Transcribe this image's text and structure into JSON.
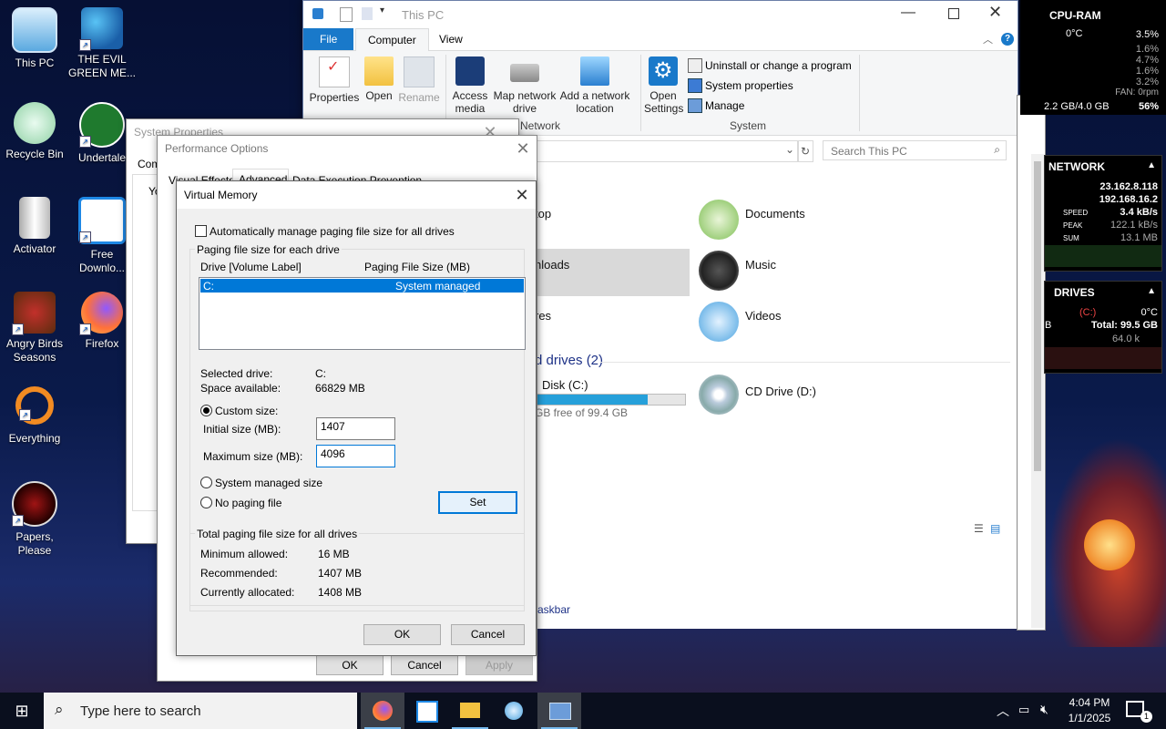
{
  "desktop_icons": [
    {
      "label": "This PC"
    },
    {
      "label": "THE EVIL GREEN ME..."
    },
    {
      "label": "Recycle Bin"
    },
    {
      "label": "Undertale"
    },
    {
      "label": "Activator"
    },
    {
      "label": "Free Downlo..."
    },
    {
      "label": "Angry Birds Seasons"
    },
    {
      "label": "Firefox"
    },
    {
      "label": "Everything"
    },
    {
      "label": "Papers, Please"
    }
  ],
  "explorer": {
    "title": "This PC",
    "tabs": [
      "File",
      "Computer",
      "View"
    ],
    "ribbon": {
      "properties": "Properties",
      "open": "Open",
      "rename": "Rename",
      "access_media": "Access media",
      "map_drive": "Map network drive",
      "add_location": "Add a network location",
      "network_group": "Network",
      "open_settings": "Open Settings",
      "uninstall": "Uninstall or change a program",
      "system_properties": "System properties",
      "manage": "Manage",
      "system_group": "System"
    },
    "search_placeholder": "Search This PC",
    "folders": [
      "top",
      "nloads",
      "res"
    ],
    "folders_right": [
      "Documents",
      "Music",
      "Videos"
    ],
    "drives_heading": "d drives (2)",
    "c_drive_label": "Disk (C:)",
    "c_drive_free": "GB free of 99.4 GB",
    "c_drive_used_fraction": 0.75,
    "d_drive_label": "CD Drive (D:)",
    "partial_text_1": "askbar"
  },
  "system_properties": {
    "title": "System Properties",
    "tab_partial": "Com",
    "y_partial": "Yo"
  },
  "performance_options": {
    "title": "Performance Options",
    "tabs": [
      "Visual Effects",
      "Advanced",
      "Data Execution Prevention"
    ],
    "ok": "OK",
    "cancel": "Cancel",
    "apply": "Apply"
  },
  "virtual_memory": {
    "title": "Virtual Memory",
    "auto_manage": "Automatically manage paging file size for all drives",
    "group_each_drive": "Paging file size for each drive",
    "col_drive": "Drive  [Volume Label]",
    "col_size": "Paging File Size (MB)",
    "rows": [
      {
        "drive": "C:",
        "size": "System managed"
      }
    ],
    "selected_drive_label": "Selected drive:",
    "selected_drive_value": "C:",
    "space_available_label": "Space available:",
    "space_available_value": "66829 MB",
    "custom_size": "Custom size:",
    "initial_size_label": "Initial size (MB):",
    "initial_size_value": "1407",
    "max_size_label": "Maximum size (MB):",
    "max_size_value": "4096",
    "system_managed": "System managed size",
    "no_paging": "No paging file",
    "set": "Set",
    "total_group": "Total paging file size for all drives",
    "min_label": "Minimum allowed:",
    "min_value": "16 MB",
    "rec_label": "Recommended:",
    "rec_value": "1407 MB",
    "cur_label": "Currently allocated:",
    "cur_value": "1408 MB",
    "ok": "OK",
    "cancel": "Cancel"
  },
  "widgets": {
    "cpu": {
      "title": "CPU-RAM",
      "temp": "0°C",
      "rows": [
        "3.5%",
        "1.6%",
        "4.7%",
        "1.6%",
        "3.2%"
      ],
      "fan": "FAN: 0rpm",
      "ram": "2.2 GB/4.0 GB",
      "ram_pct": "56%"
    },
    "network": {
      "title": "NETWORK",
      "ip1": "23.162.8.118",
      "ip2": "192.168.16.2",
      "speed_label": "SPEED",
      "speed": "3.4 kB/s",
      "peak_label": "PEAK",
      "peak": "122.1 kB/s",
      "sum_label": "SUM",
      "sum": "13.1 MB"
    },
    "drives": {
      "title": "DRIVES",
      "temp": "0°C",
      "drive": "(C:)",
      "total": "Total: 99.5 GB",
      "rate": "64.0 k",
      "partial": "B"
    }
  },
  "taskbar": {
    "search_placeholder": "Type here to search",
    "time": "4:04 PM",
    "date": "1/1/2025",
    "notif_count": "1"
  }
}
